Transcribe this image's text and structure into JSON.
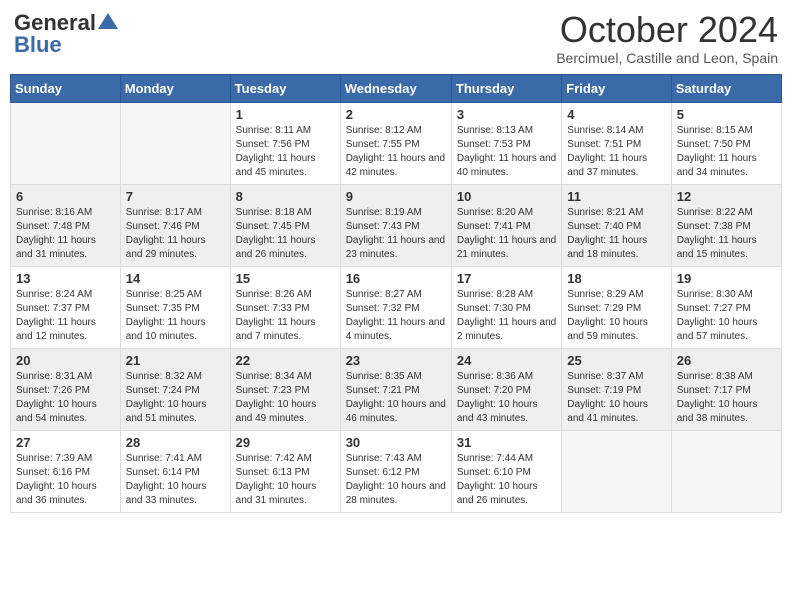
{
  "header": {
    "logo_general": "General",
    "logo_blue": "Blue",
    "month_title": "October 2024",
    "location": "Bercimuel, Castille and Leon, Spain"
  },
  "weekdays": [
    "Sunday",
    "Monday",
    "Tuesday",
    "Wednesday",
    "Thursday",
    "Friday",
    "Saturday"
  ],
  "weeks": [
    [
      {
        "day": "",
        "sunrise": "",
        "sunset": "",
        "daylight": ""
      },
      {
        "day": "",
        "sunrise": "",
        "sunset": "",
        "daylight": ""
      },
      {
        "day": "1",
        "sunrise": "Sunrise: 8:11 AM",
        "sunset": "Sunset: 7:56 PM",
        "daylight": "Daylight: 11 hours and 45 minutes."
      },
      {
        "day": "2",
        "sunrise": "Sunrise: 8:12 AM",
        "sunset": "Sunset: 7:55 PM",
        "daylight": "Daylight: 11 hours and 42 minutes."
      },
      {
        "day": "3",
        "sunrise": "Sunrise: 8:13 AM",
        "sunset": "Sunset: 7:53 PM",
        "daylight": "Daylight: 11 hours and 40 minutes."
      },
      {
        "day": "4",
        "sunrise": "Sunrise: 8:14 AM",
        "sunset": "Sunset: 7:51 PM",
        "daylight": "Daylight: 11 hours and 37 minutes."
      },
      {
        "day": "5",
        "sunrise": "Sunrise: 8:15 AM",
        "sunset": "Sunset: 7:50 PM",
        "daylight": "Daylight: 11 hours and 34 minutes."
      }
    ],
    [
      {
        "day": "6",
        "sunrise": "Sunrise: 8:16 AM",
        "sunset": "Sunset: 7:48 PM",
        "daylight": "Daylight: 11 hours and 31 minutes."
      },
      {
        "day": "7",
        "sunrise": "Sunrise: 8:17 AM",
        "sunset": "Sunset: 7:46 PM",
        "daylight": "Daylight: 11 hours and 29 minutes."
      },
      {
        "day": "8",
        "sunrise": "Sunrise: 8:18 AM",
        "sunset": "Sunset: 7:45 PM",
        "daylight": "Daylight: 11 hours and 26 minutes."
      },
      {
        "day": "9",
        "sunrise": "Sunrise: 8:19 AM",
        "sunset": "Sunset: 7:43 PM",
        "daylight": "Daylight: 11 hours and 23 minutes."
      },
      {
        "day": "10",
        "sunrise": "Sunrise: 8:20 AM",
        "sunset": "Sunset: 7:41 PM",
        "daylight": "Daylight: 11 hours and 21 minutes."
      },
      {
        "day": "11",
        "sunrise": "Sunrise: 8:21 AM",
        "sunset": "Sunset: 7:40 PM",
        "daylight": "Daylight: 11 hours and 18 minutes."
      },
      {
        "day": "12",
        "sunrise": "Sunrise: 8:22 AM",
        "sunset": "Sunset: 7:38 PM",
        "daylight": "Daylight: 11 hours and 15 minutes."
      }
    ],
    [
      {
        "day": "13",
        "sunrise": "Sunrise: 8:24 AM",
        "sunset": "Sunset: 7:37 PM",
        "daylight": "Daylight: 11 hours and 12 minutes."
      },
      {
        "day": "14",
        "sunrise": "Sunrise: 8:25 AM",
        "sunset": "Sunset: 7:35 PM",
        "daylight": "Daylight: 11 hours and 10 minutes."
      },
      {
        "day": "15",
        "sunrise": "Sunrise: 8:26 AM",
        "sunset": "Sunset: 7:33 PM",
        "daylight": "Daylight: 11 hours and 7 minutes."
      },
      {
        "day": "16",
        "sunrise": "Sunrise: 8:27 AM",
        "sunset": "Sunset: 7:32 PM",
        "daylight": "Daylight: 11 hours and 4 minutes."
      },
      {
        "day": "17",
        "sunrise": "Sunrise: 8:28 AM",
        "sunset": "Sunset: 7:30 PM",
        "daylight": "Daylight: 11 hours and 2 minutes."
      },
      {
        "day": "18",
        "sunrise": "Sunrise: 8:29 AM",
        "sunset": "Sunset: 7:29 PM",
        "daylight": "Daylight: 10 hours and 59 minutes."
      },
      {
        "day": "19",
        "sunrise": "Sunrise: 8:30 AM",
        "sunset": "Sunset: 7:27 PM",
        "daylight": "Daylight: 10 hours and 57 minutes."
      }
    ],
    [
      {
        "day": "20",
        "sunrise": "Sunrise: 8:31 AM",
        "sunset": "Sunset: 7:26 PM",
        "daylight": "Daylight: 10 hours and 54 minutes."
      },
      {
        "day": "21",
        "sunrise": "Sunrise: 8:32 AM",
        "sunset": "Sunset: 7:24 PM",
        "daylight": "Daylight: 10 hours and 51 minutes."
      },
      {
        "day": "22",
        "sunrise": "Sunrise: 8:34 AM",
        "sunset": "Sunset: 7:23 PM",
        "daylight": "Daylight: 10 hours and 49 minutes."
      },
      {
        "day": "23",
        "sunrise": "Sunrise: 8:35 AM",
        "sunset": "Sunset: 7:21 PM",
        "daylight": "Daylight: 10 hours and 46 minutes."
      },
      {
        "day": "24",
        "sunrise": "Sunrise: 8:36 AM",
        "sunset": "Sunset: 7:20 PM",
        "daylight": "Daylight: 10 hours and 43 minutes."
      },
      {
        "day": "25",
        "sunrise": "Sunrise: 8:37 AM",
        "sunset": "Sunset: 7:19 PM",
        "daylight": "Daylight: 10 hours and 41 minutes."
      },
      {
        "day": "26",
        "sunrise": "Sunrise: 8:38 AM",
        "sunset": "Sunset: 7:17 PM",
        "daylight": "Daylight: 10 hours and 38 minutes."
      }
    ],
    [
      {
        "day": "27",
        "sunrise": "Sunrise: 7:39 AM",
        "sunset": "Sunset: 6:16 PM",
        "daylight": "Daylight: 10 hours and 36 minutes."
      },
      {
        "day": "28",
        "sunrise": "Sunrise: 7:41 AM",
        "sunset": "Sunset: 6:14 PM",
        "daylight": "Daylight: 10 hours and 33 minutes."
      },
      {
        "day": "29",
        "sunrise": "Sunrise: 7:42 AM",
        "sunset": "Sunset: 6:13 PM",
        "daylight": "Daylight: 10 hours and 31 minutes."
      },
      {
        "day": "30",
        "sunrise": "Sunrise: 7:43 AM",
        "sunset": "Sunset: 6:12 PM",
        "daylight": "Daylight: 10 hours and 28 minutes."
      },
      {
        "day": "31",
        "sunrise": "Sunrise: 7:44 AM",
        "sunset": "Sunset: 6:10 PM",
        "daylight": "Daylight: 10 hours and 26 minutes."
      },
      {
        "day": "",
        "sunrise": "",
        "sunset": "",
        "daylight": ""
      },
      {
        "day": "",
        "sunrise": "",
        "sunset": "",
        "daylight": ""
      }
    ]
  ]
}
